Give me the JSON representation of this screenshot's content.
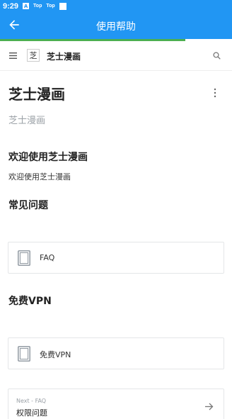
{
  "status_bar": {
    "time": "9:29",
    "badge": "A",
    "item1": "Top",
    "item2": "Top"
  },
  "app_bar": {
    "title": "使用帮助"
  },
  "progress": {
    "fraction": 0.8
  },
  "site_header": {
    "logo_text": "芝",
    "site_name": "芝士漫画"
  },
  "page": {
    "title": "芝士漫画",
    "subtitle": "芝士漫画",
    "welcome_heading": "欢迎使用芝士漫画",
    "welcome_text": "欢迎使用芝士漫画",
    "faq_heading": "常见问题",
    "faq_card_label": "FAQ",
    "vpn_heading": "免费VPN",
    "vpn_card_label": "免费VPN"
  },
  "next_nav": {
    "small": "Next - FAQ",
    "title": "权限问题"
  },
  "colors": {
    "primary": "#2196f3",
    "progress": "#4caf50",
    "muted": "#9aa0a6"
  },
  "icons": [
    "back-arrow-icon",
    "menu-icon",
    "search-icon",
    "more-vert-icon",
    "document-icon",
    "arrow-right-icon"
  ]
}
